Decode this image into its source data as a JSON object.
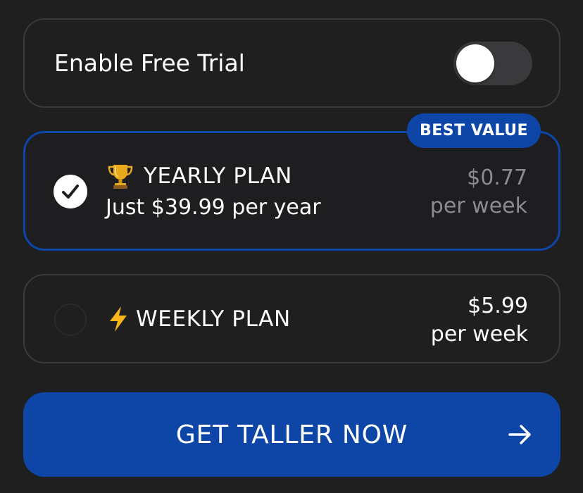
{
  "free_trial": {
    "label": "Enable Free Trial",
    "enabled": false
  },
  "plans": [
    {
      "id": "yearly",
      "icon": "trophy-icon",
      "title": "YEARLY PLAN",
      "subtitle": "Just $39.99 per year",
      "price": "$0.77",
      "price_unit": "per week",
      "badge": "BEST VALUE",
      "selected": true
    },
    {
      "id": "weekly",
      "icon": "lightning-bolt-icon",
      "title": "WEEKLY PLAN",
      "price": "$5.99",
      "price_unit": "per week",
      "selected": false
    }
  ],
  "cta": {
    "label": "GET TALLER NOW",
    "icon": "arrow-right-icon"
  },
  "colors": {
    "background": "#1f1f20",
    "accent": "#0e46a8",
    "card_border": "#3a3a3c",
    "muted_text": "#8c8c90",
    "text": "#ffffff"
  }
}
